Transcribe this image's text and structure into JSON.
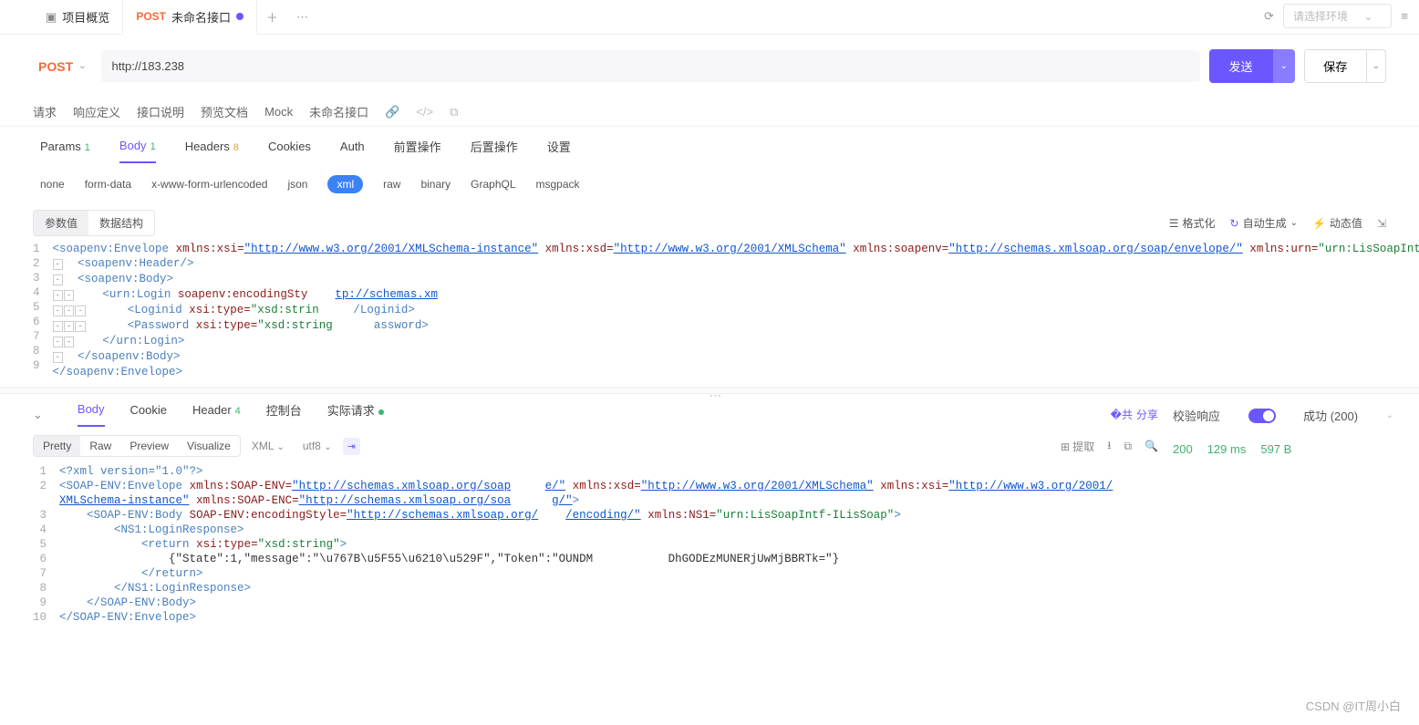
{
  "tabs": {
    "overview": "项目概览",
    "active_method": "POST",
    "active_name": "未命名接口"
  },
  "env": {
    "placeholder": "请选择环境"
  },
  "request": {
    "method": "POST",
    "url": "http://183.238",
    "send": "发送",
    "save": "保存"
  },
  "subnav": {
    "a": "请求",
    "b": "响应定义",
    "c": "接口说明",
    "d": "预览文档",
    "e": "Mock",
    "f": "未命名接口"
  },
  "reqTabs": {
    "params": "Params",
    "params_n": "1",
    "body": "Body",
    "body_n": "1",
    "headers": "Headers",
    "headers_n": "8",
    "cookies": "Cookies",
    "auth": "Auth",
    "pre": "前置操作",
    "post": "后置操作",
    "settings": "设置"
  },
  "bodyTypes": {
    "none": "none",
    "form": "form-data",
    "url": "x-www-form-urlencoded",
    "json": "json",
    "xml": "xml",
    "raw": "raw",
    "binary": "binary",
    "gql": "GraphQL",
    "msg": "msgpack"
  },
  "seg": {
    "val": "参数值",
    "struct": "数据结构"
  },
  "codeActions": {
    "fmt": "格式化",
    "gen": "自动生成",
    "dyn": "动态值"
  },
  "chart_data": null,
  "reqCode": {
    "l1a": "<soapenv:Envelope",
    "l1b": "xmlns:xsi=",
    "l1c": "\"http://www.w3.org/2001/XMLSchema-instance\"",
    "l1d": "xmlns:xsd=",
    "l1e": "\"http://www.w3.org/2001/XMLSchema\"",
    "l1f": "xmlns:soapenv=",
    "l1g": "\"http://schemas.xmlsoap.org/soap/envelope/\"",
    "l1h": "xmlns:urn=",
    "l1i": "\"urn:LisSoapIntf-ILisSoap\"",
    "l1j": ">",
    "l2": "<soapenv:Header/>",
    "l3": "<soapenv:Body>",
    "l4a": "<urn:Login",
    "l4b": "soapenv:encodingSty",
    "l4c": "tp://schemas.xm",
    "l5a": "<Loginid",
    "l5b": "xsi:type=",
    "l5c": "\"xsd:strin",
    "l5d": "/Loginid>",
    "l6a": "<Password",
    "l6b": "xsi:type=",
    "l6c": "\"xsd:string",
    "l6d": "assword>",
    "l7": "</urn:Login>",
    "l8": "</soapenv:Body>",
    "l9": "</soapenv:Envelope>"
  },
  "respTabs": {
    "body": "Body",
    "cookie": "Cookie",
    "header": "Header",
    "header_n": "4",
    "console": "控制台",
    "actual": "实际请求",
    "share": "分享"
  },
  "respSide": {
    "verify": "校验响应",
    "status": "成功 (200)",
    "code": "200",
    "time": "129 ms",
    "size": "597 B"
  },
  "fmt": {
    "pretty": "Pretty",
    "raw": "Raw",
    "preview": "Preview",
    "vis": "Visualize",
    "lang": "XML",
    "enc": "utf8",
    "extract": "提取"
  },
  "respCode": {
    "l1": "<?xml version=\"1.0\"?>",
    "l2a": "<SOAP-ENV:Envelope",
    "l2b": "xmlns:SOAP-ENV=",
    "l2c": "\"http://schemas.xmlsoap.org/soap",
    "l2d": "e/\"",
    "l2e": "xmlns:xsd=",
    "l2f": "\"http://www.w3.org/2001/XMLSchema\"",
    "l2g": "xmlns:xsi=",
    "l2h": "\"http://www.w3.org/2001/",
    "l2i": "XMLSchema-instance\"",
    "l2j": "xmlns:SOAP-ENC=",
    "l2k": "\"http://schemas.xmlsoap.org/soa",
    "l2l": "g/\"",
    "l2m": ">",
    "l3a": "<SOAP-ENV:Body",
    "l3b": "SOAP-ENV:encodingStyle=",
    "l3c": "\"http://schemas.xmlsoap.org/",
    "l3d": "/encoding/\"",
    "l3e": "xmlns:NS1=",
    "l3f": "\"urn:LisSoapIntf-ILisSoap\"",
    "l3g": ">",
    "l4": "<NS1:LoginResponse>",
    "l5a": "<return",
    "l5b": "xsi:type=",
    "l5c": "\"xsd:string\"",
    "l5d": ">",
    "l6": "{\"State\":1,\"message\":\"\\u767B\\u5F55\\u6210\\u529F\",\"Token\":\"OUNDM           DhGODEzMUNERjUwMjBBRTk=\"}",
    "l7": "</return>",
    "l8": "</NS1:LoginResponse>",
    "l9": "</SOAP-ENV:Body>",
    "l10": "</SOAP-ENV:Envelope>"
  },
  "wm": "CSDN @IT周小白"
}
